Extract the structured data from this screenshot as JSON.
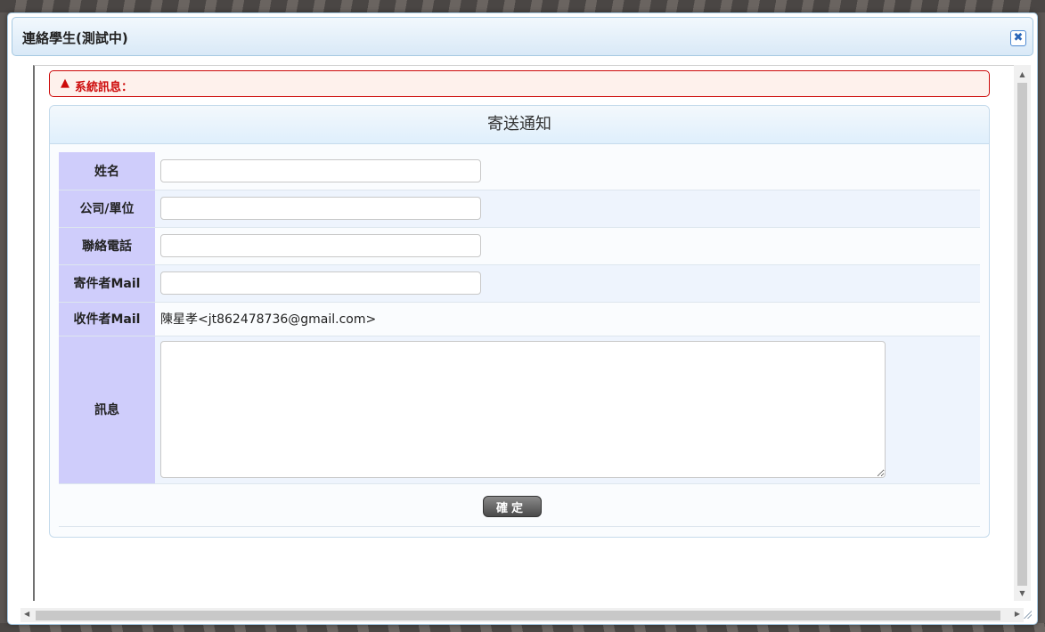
{
  "dialog": {
    "title": "連絡學生(測試中)",
    "close_symbol": "✖"
  },
  "notice": {
    "icon": "warning-icon",
    "icon_glyph": "▲",
    "text": "系統訊息："
  },
  "form": {
    "heading": "寄送通知",
    "name_label": "姓名",
    "name_value": "",
    "company_label": "公司/單位",
    "company_value": "",
    "phone_label": "聯絡電話",
    "phone_value": "",
    "sender_label": "寄件者Mail",
    "sender_value": "",
    "recipient_label": "收件者Mail",
    "recipient_value": "陳星孝<jt862478736@gmail.com>",
    "message_label": "訊息",
    "message_value": "",
    "submit_label": "確定"
  },
  "colors": {
    "error": "#cd0a0a",
    "label_bg": "#cfcdfb",
    "header_bg": "#dfeffc",
    "border": "#a6c9e2"
  }
}
